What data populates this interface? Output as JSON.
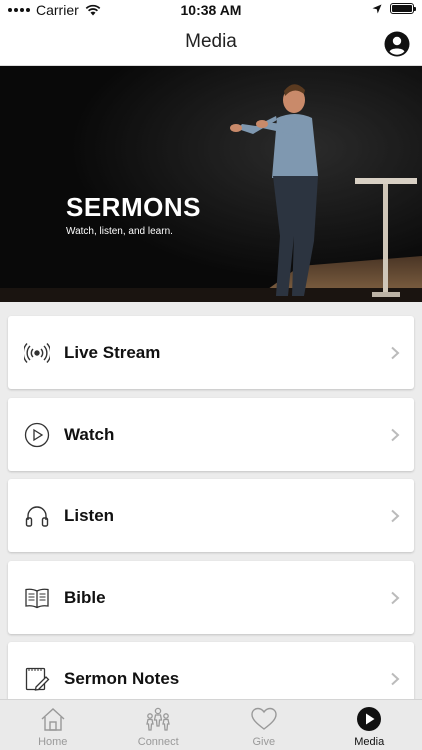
{
  "status_bar": {
    "carrier": "Carrier",
    "time": "10:38 AM"
  },
  "navbar": {
    "title": "Media"
  },
  "hero": {
    "title": "SERMONS",
    "subtitle": "Watch, listen, and learn."
  },
  "menu": [
    {
      "label": "Live Stream",
      "icon": "live-stream-icon"
    },
    {
      "label": "Watch",
      "icon": "play-circle-icon"
    },
    {
      "label": "Listen",
      "icon": "headphones-icon"
    },
    {
      "label": "Bible",
      "icon": "book-icon"
    },
    {
      "label": "Sermon Notes",
      "icon": "notes-icon"
    }
  ],
  "tabs": [
    {
      "label": "Home",
      "icon": "home-icon",
      "active": false
    },
    {
      "label": "Connect",
      "icon": "people-icon",
      "active": false
    },
    {
      "label": "Give",
      "icon": "heart-icon",
      "active": false
    },
    {
      "label": "Media",
      "icon": "play-icon",
      "active": true
    }
  ],
  "colors": {
    "background": "#ececec",
    "tab_active": "#111111",
    "tab_inactive": "#999999"
  }
}
